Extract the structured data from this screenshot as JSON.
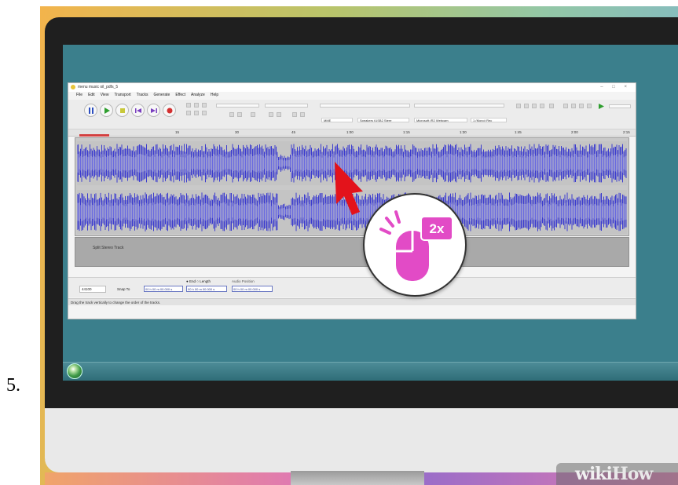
{
  "step": {
    "number": "5."
  },
  "app": {
    "title": "menu music oil_pdfs_5",
    "menu": [
      "File",
      "Edit",
      "View",
      "Transport",
      "Tracks",
      "Generate",
      "Effect",
      "Analyze",
      "Help"
    ],
    "devices": {
      "host": "MME",
      "output": "Speakers (USB2 Stere",
      "input": "Microsoft (R2 Webcam",
      "channels": "1 (Mono) Rec"
    },
    "ruler_ticks": [
      "15",
      "30",
      "45",
      "1:00",
      "1:15",
      "1:30",
      "1:45",
      "2:00",
      "2:15"
    ],
    "split_label": "Split Stereo Track",
    "selection": {
      "project_rate": "44100",
      "snap_to": "Snap To",
      "start": "00 h 00 m 00.000 s",
      "end": "00 h 00 m 00.000 s",
      "audio_position": "00 h 00 m 00.000 s",
      "end_label": "End",
      "length_label": "Length",
      "audio_position_label": "Audio Position"
    },
    "status": "Drag the track vertically to change the order of the tracks."
  },
  "overlay": {
    "badge_icon": "mouse-double-click-icon",
    "badge_text": "2x",
    "cursor_icon": "red-arrow-cursor-icon"
  },
  "watermark": {
    "wiki": "wiki",
    "how": "How"
  },
  "colors": {
    "wave": "#3b3bcf",
    "wave_light": "#6a6ae0",
    "screen": "#3b7f8c",
    "accent_pink": "#e24bc6",
    "cursor_red": "#e3131b"
  }
}
